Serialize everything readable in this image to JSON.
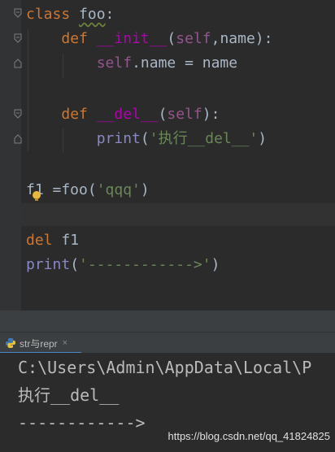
{
  "editor": {
    "lines": [
      {
        "tokens": [
          {
            "t": "class",
            "c": "kw"
          },
          {
            "t": " "
          },
          {
            "t": "foo",
            "c": "cls"
          },
          {
            "t": ":"
          }
        ]
      },
      {
        "tokens": [
          {
            "t": "    "
          },
          {
            "t": "def",
            "c": "kw"
          },
          {
            "t": " "
          },
          {
            "t": "__init__",
            "c": "magic"
          },
          {
            "t": "("
          },
          {
            "t": "self",
            "c": "self"
          },
          {
            "t": ",name):"
          }
        ]
      },
      {
        "tokens": [
          {
            "t": "        "
          },
          {
            "t": "self",
            "c": "self"
          },
          {
            "t": ".name = name"
          }
        ]
      },
      {
        "tokens": []
      },
      {
        "tokens": [
          {
            "t": "    "
          },
          {
            "t": "def",
            "c": "kw"
          },
          {
            "t": " "
          },
          {
            "t": "__del__",
            "c": "magic"
          },
          {
            "t": "("
          },
          {
            "t": "self",
            "c": "self"
          },
          {
            "t": "):"
          }
        ]
      },
      {
        "tokens": [
          {
            "t": "        "
          },
          {
            "t": "print",
            "c": "builtin"
          },
          {
            "t": "("
          },
          {
            "t": "'执行__del__'",
            "c": "str"
          },
          {
            "t": ")"
          }
        ]
      },
      {
        "tokens": []
      },
      {
        "tokens": [
          {
            "t": "f1 =foo("
          },
          {
            "t": "'qqq'",
            "c": "str"
          },
          {
            "t": ")"
          }
        ]
      },
      {
        "tokens": []
      },
      {
        "tokens": [
          {
            "t": "del",
            "c": "kw"
          },
          {
            "t": " f1"
          }
        ]
      },
      {
        "tokens": [
          {
            "t": "print",
            "c": "builtin"
          },
          {
            "t": "("
          },
          {
            "t": "'------------>'",
            "c": "str"
          },
          {
            "t": ")"
          }
        ]
      }
    ]
  },
  "run_panel": {
    "tab_label": "str与repr",
    "close_glyph": "×",
    "output": [
      "C:\\Users\\Admin\\AppData\\Local\\P",
      "执行__del__",
      "------------>"
    ]
  },
  "watermark": "https://blog.csdn.net/qq_41824825",
  "colors": {
    "background": "#2b2b2b",
    "keyword": "#cc7832",
    "self": "#94558d",
    "magic": "#b200b2",
    "string": "#6a8759",
    "builtin": "#8888c6",
    "text": "#a9b7c6"
  }
}
